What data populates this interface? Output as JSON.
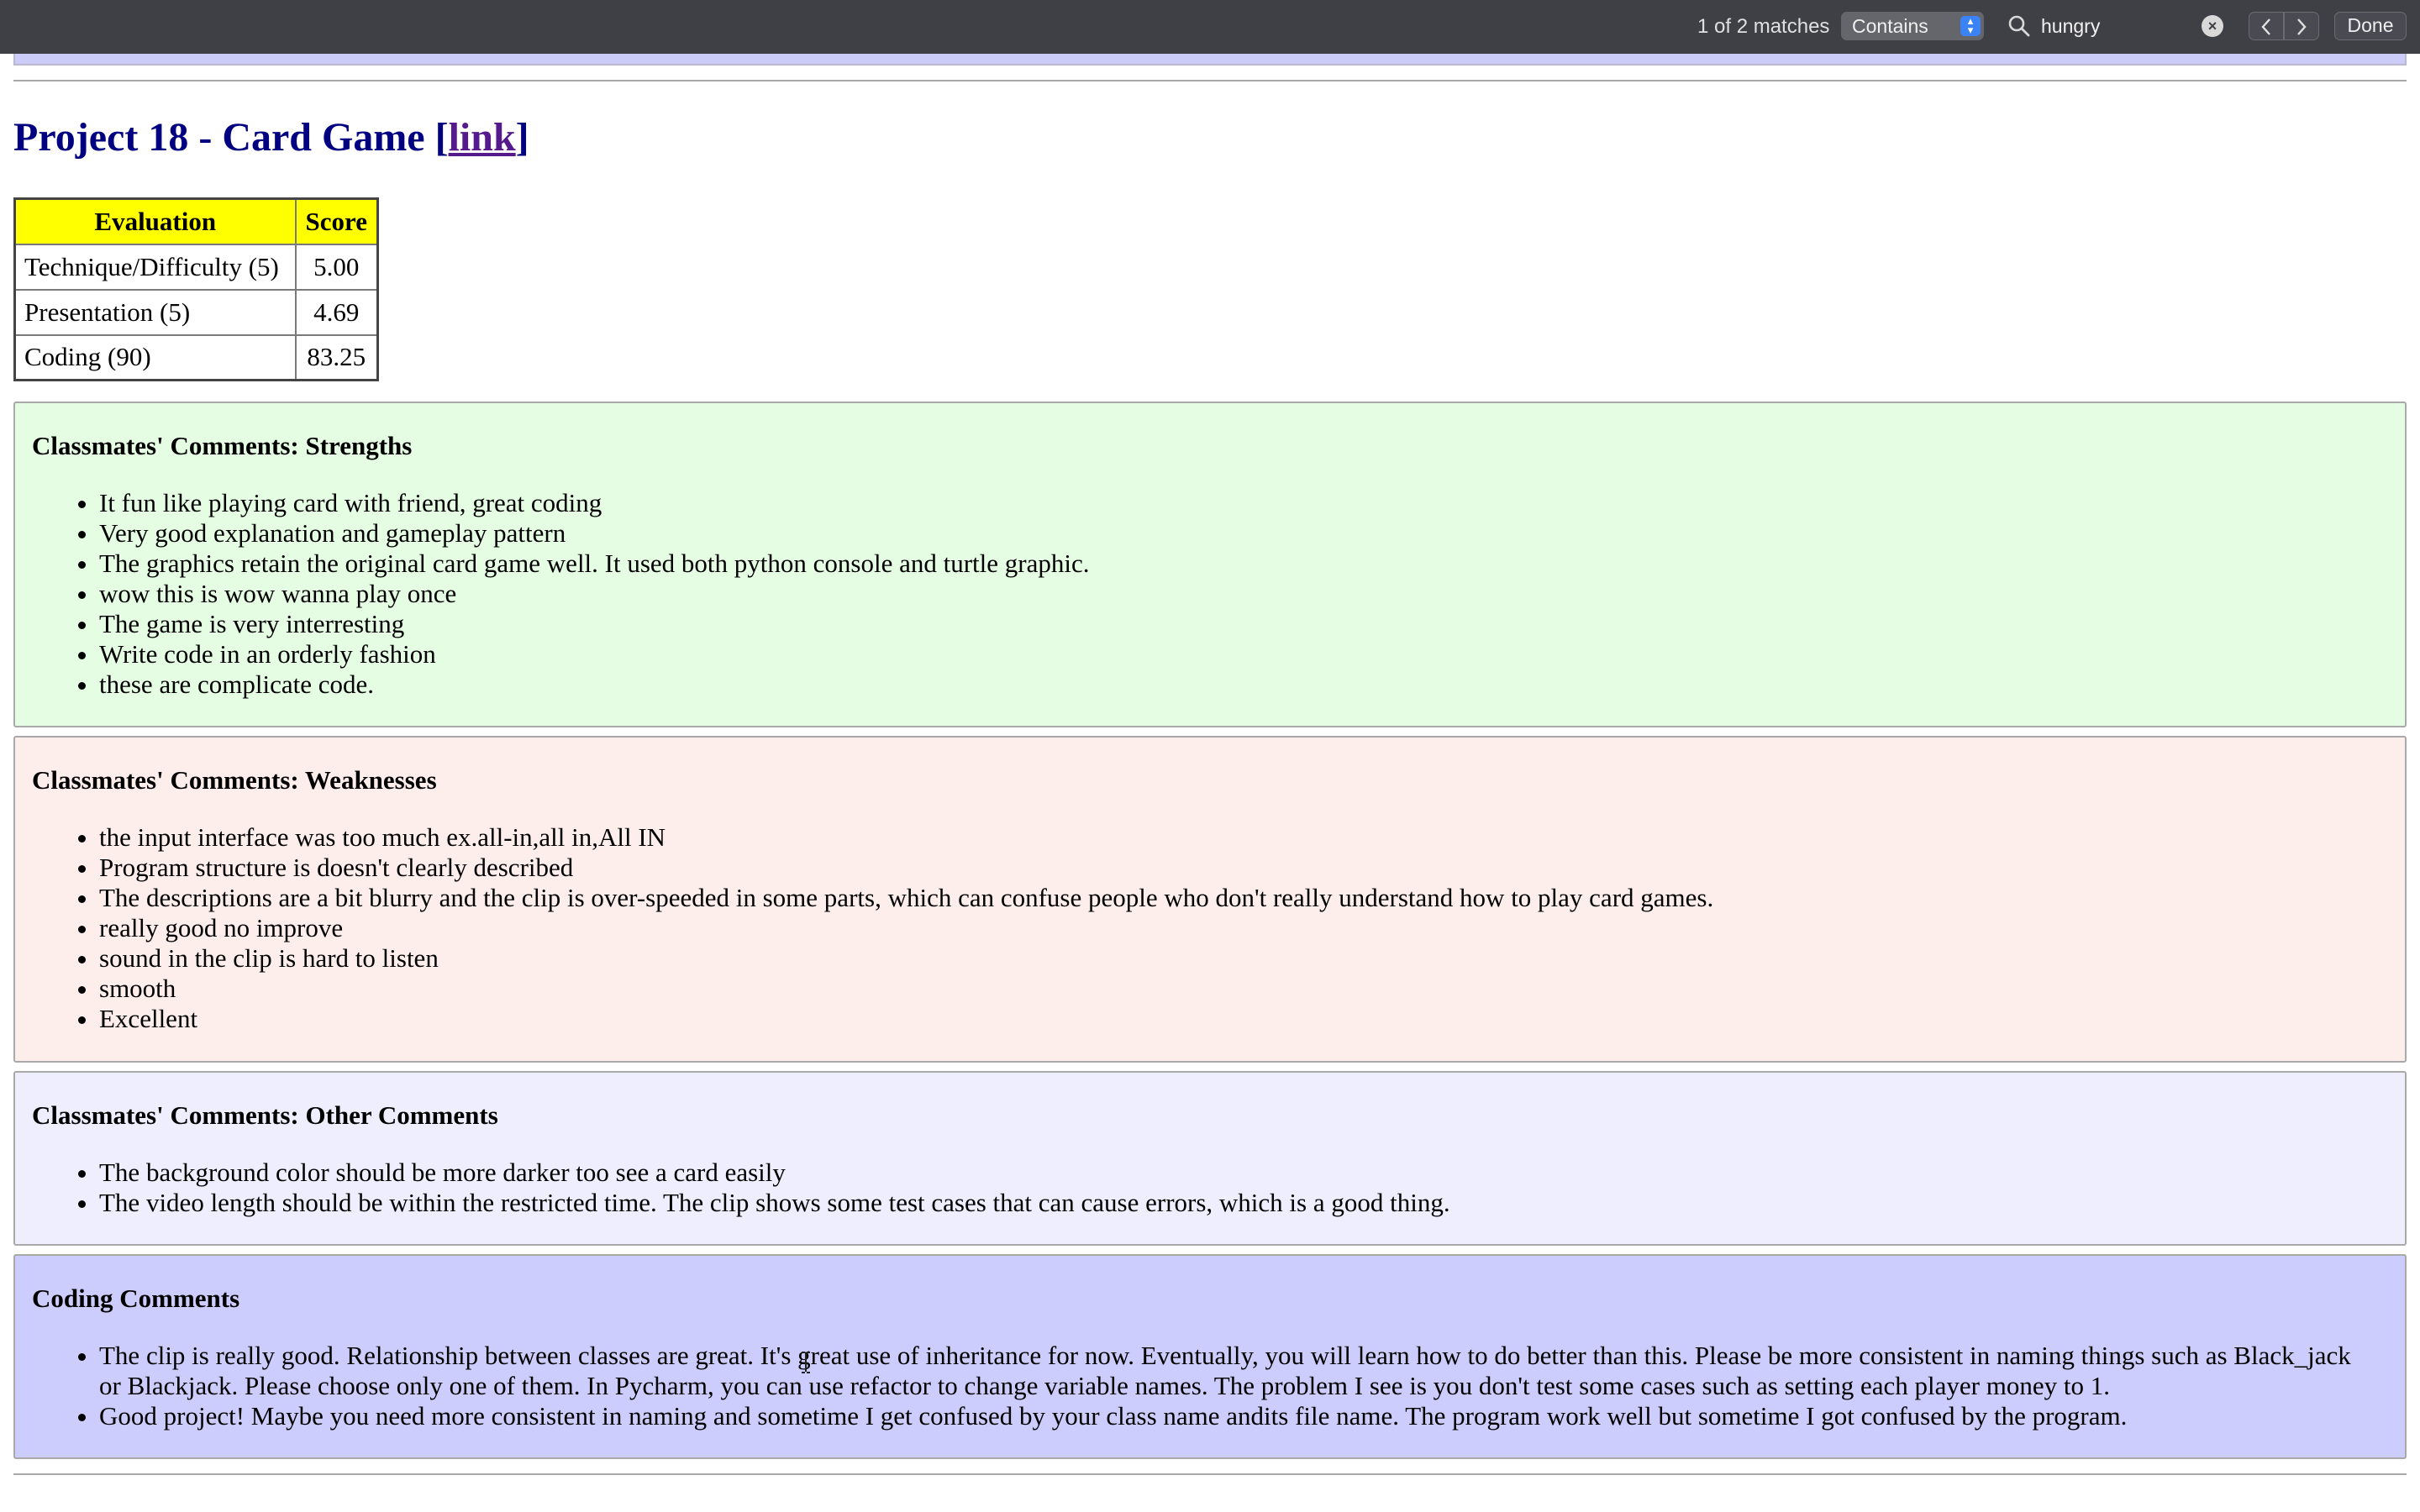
{
  "find_bar": {
    "match_count": "1 of 2 matches",
    "mode": "Contains",
    "query": "hungry",
    "done_label": "Done",
    "icons": {
      "search": "search-icon",
      "clear": "clear-icon",
      "prev": "chevron-left-icon",
      "next": "chevron-right-icon",
      "mode_arrows": "updown-arrows-icon"
    }
  },
  "project": {
    "title": "Project 18 - Card Game [",
    "link_label": "link",
    "title_end": "]"
  },
  "evaluation": {
    "headers": [
      "Evaluation",
      "Score"
    ],
    "rows": [
      {
        "label": "Technique/Difficulty (5)",
        "score": "5.00"
      },
      {
        "label": "Presentation (5)",
        "score": "4.69"
      },
      {
        "label": "Coding (90)",
        "score": "83.25"
      }
    ]
  },
  "strengths": {
    "heading": "Classmates' Comments: Strengths",
    "items": [
      "It fun like playing card with friend, great coding",
      "Very good explanation and gameplay pattern",
      "The graphics retain the original card game well. It used both python console and turtle graphic.",
      "wow this is wow wanna play once",
      "The game is very interresting",
      "Write code in an orderly fashion",
      "these are complicate code."
    ]
  },
  "weaknesses": {
    "heading": "Classmates' Comments: Weaknesses",
    "items": [
      "the input interface was too much ex.all-in,all in,All IN",
      "Program structure is doesn't clearly described",
      "The descriptions are a bit blurry and the clip is over-speeded in some parts, which can confuse people who don't really understand how to play card games.",
      "really good no improve",
      "sound in the clip is hard to listen",
      "smooth",
      "Excellent"
    ]
  },
  "other": {
    "heading": "Classmates' Comments: Other Comments",
    "items": [
      "The background color should be more darker too see a card easily",
      "The video length should be within the restricted time. The clip shows some test cases that can cause errors, which is a good thing."
    ]
  },
  "coding": {
    "heading": "Coding Comments",
    "items": [
      "The clip is really good. Relationship between classes are great. It's great use of inheritance for now. Eventually, you will learn how to do better than this. Please be more consistent in naming things such as Black_jack or Blackjack. Please choose only one of them. In Pycharm, you can use refactor to change variable names. The problem I see is you don't test some cases such as setting each player money to 1.",
      "Good project! Maybe you need more consistent in naming and sometime I get confused by your class name andits file name. The program work well but sometime I got confused by the program."
    ]
  },
  "colors": {
    "find_bar_bg": "#3f3f46",
    "title_color": "#000080",
    "table_header_bg": "#ffff00",
    "strengths_bg": "#e5fde3",
    "weaknesses_bg": "#fdeeeb",
    "other_bg": "#eeeefe",
    "coding_bg": "#cccdfc"
  }
}
